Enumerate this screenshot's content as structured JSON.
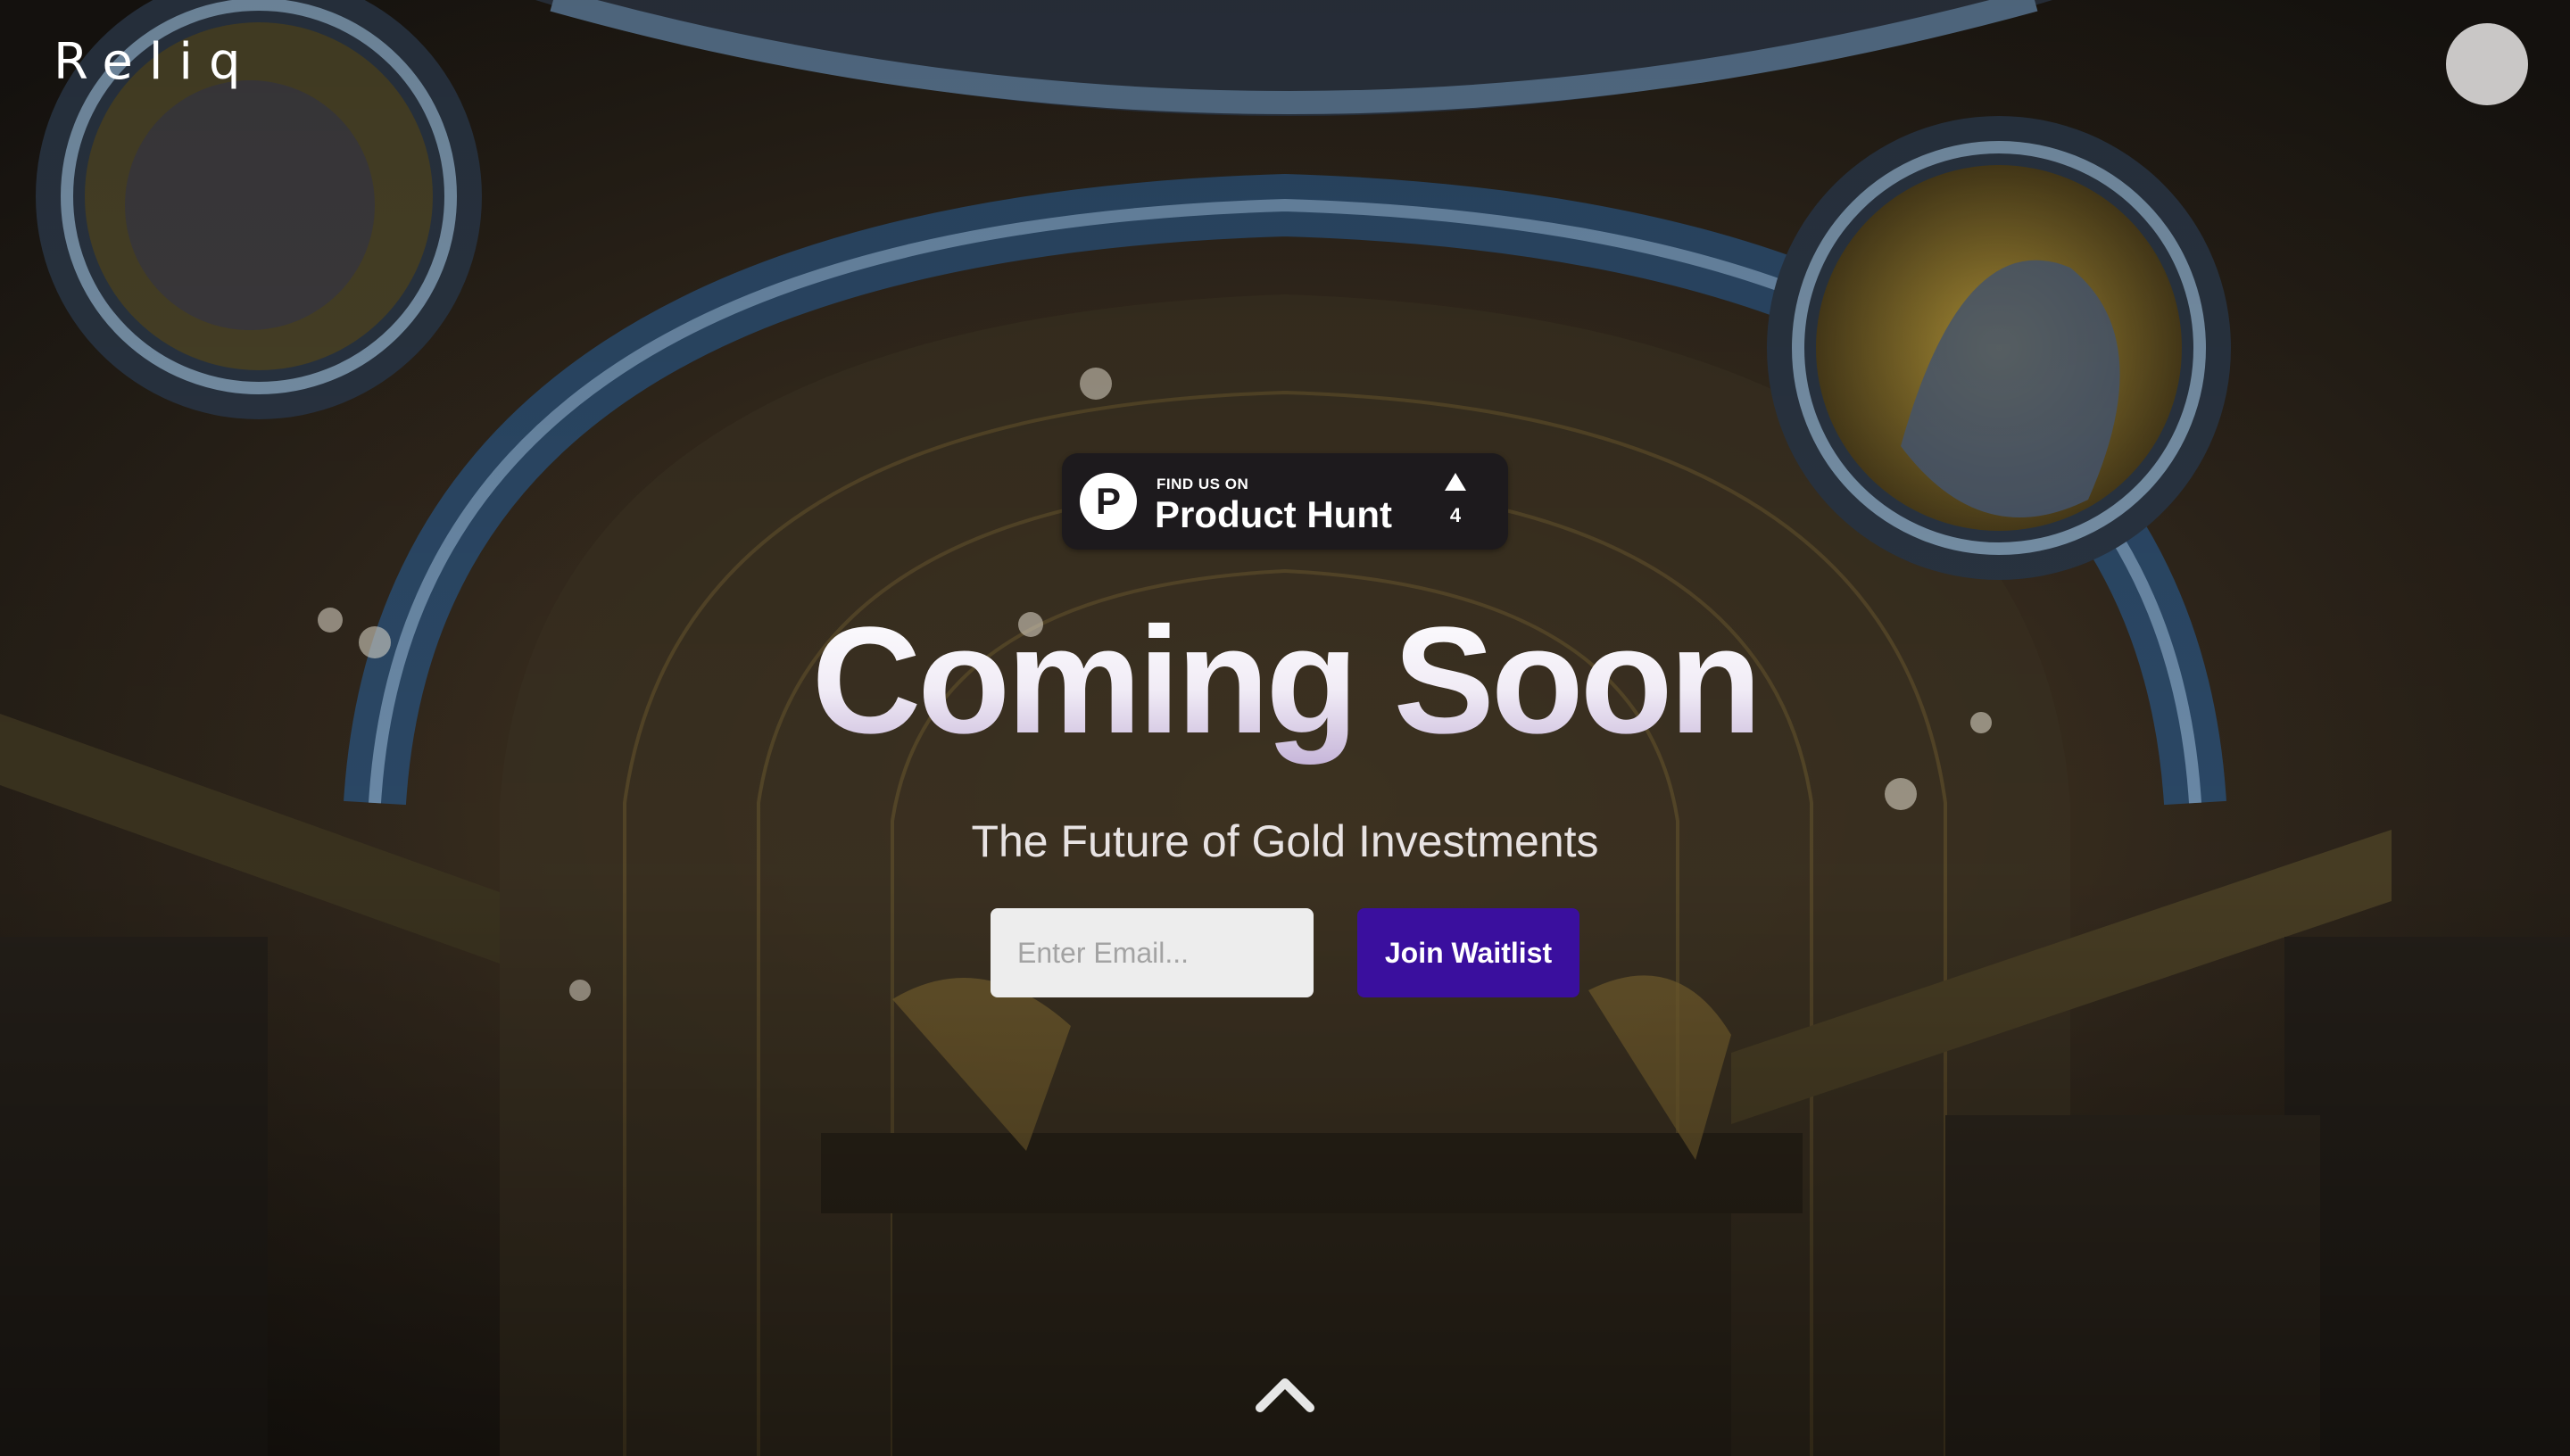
{
  "header": {
    "logo_text": "Reliq"
  },
  "product_hunt_badge": {
    "eyebrow": "FIND US ON",
    "name": "Product Hunt",
    "logo_letter": "P",
    "upvotes": "4"
  },
  "hero": {
    "title": "Coming Soon",
    "subtitle": "The Future of Gold Investments"
  },
  "waitlist": {
    "email_placeholder": "Enter Email...",
    "email_value": "",
    "button_label": "Join Waitlist"
  },
  "icons": {
    "avatar": "user-avatar",
    "scroll": "chevron-up-icon",
    "upvote": "triangle-up-icon"
  },
  "colors": {
    "button_bg": "#3a0f9e",
    "badge_bg": "#1d1a1d",
    "input_bg": "#ededed",
    "text": "#ffffff"
  }
}
